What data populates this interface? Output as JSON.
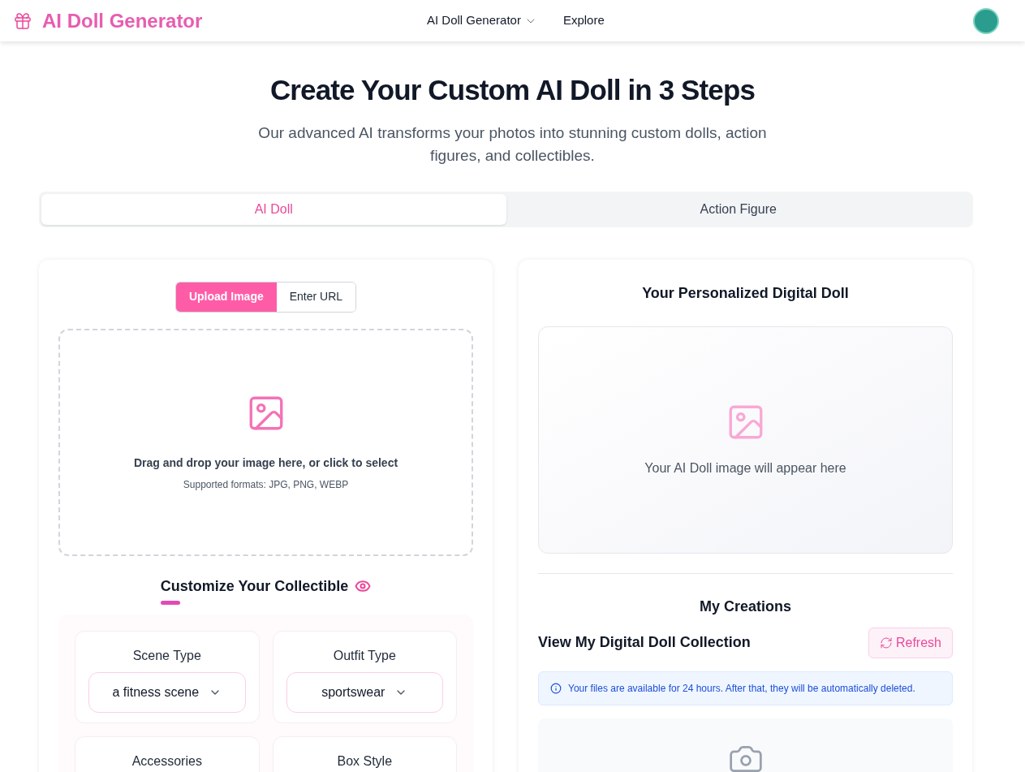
{
  "header": {
    "brand": "AI Doll Generator",
    "nav": [
      {
        "label": "AI Doll Generator",
        "kind": "dropdown"
      },
      {
        "label": "Explore",
        "kind": "link"
      }
    ]
  },
  "hero": {
    "title": "Create Your Custom AI Doll in 3 Steps",
    "subtitle": "Our advanced AI transforms your photos into stunning custom dolls, action figures, and collectibles."
  },
  "tabs": [
    {
      "label": "AI Doll",
      "selected": true
    },
    {
      "label": "Action Figure",
      "selected": false
    }
  ],
  "source_toggle": [
    {
      "label": "Upload Image",
      "selected": true
    },
    {
      "label": "Enter URL",
      "selected": false
    }
  ],
  "dropzone": {
    "text": "Drag and drop your image here, or click to select",
    "formats": "Supported formats: JPG, PNG, WEBP"
  },
  "customize": {
    "title": "Customize Your Collectible",
    "options": [
      {
        "label": "Scene Type",
        "value": "a fitness scene"
      },
      {
        "label": "Outfit Type",
        "value": "sportswear"
      },
      {
        "label": "Accessories"
      },
      {
        "label": "Box Style"
      }
    ]
  },
  "result": {
    "title": "Your Personalized Digital Doll",
    "placeholder": "Your AI Doll image will appear here"
  },
  "creations": {
    "title": "My Creations",
    "subtitle": "View My Digital Doll Collection",
    "refresh": "Refresh",
    "notice": "Your files are available for 24 hours. After that, they will be automatically deleted."
  }
}
